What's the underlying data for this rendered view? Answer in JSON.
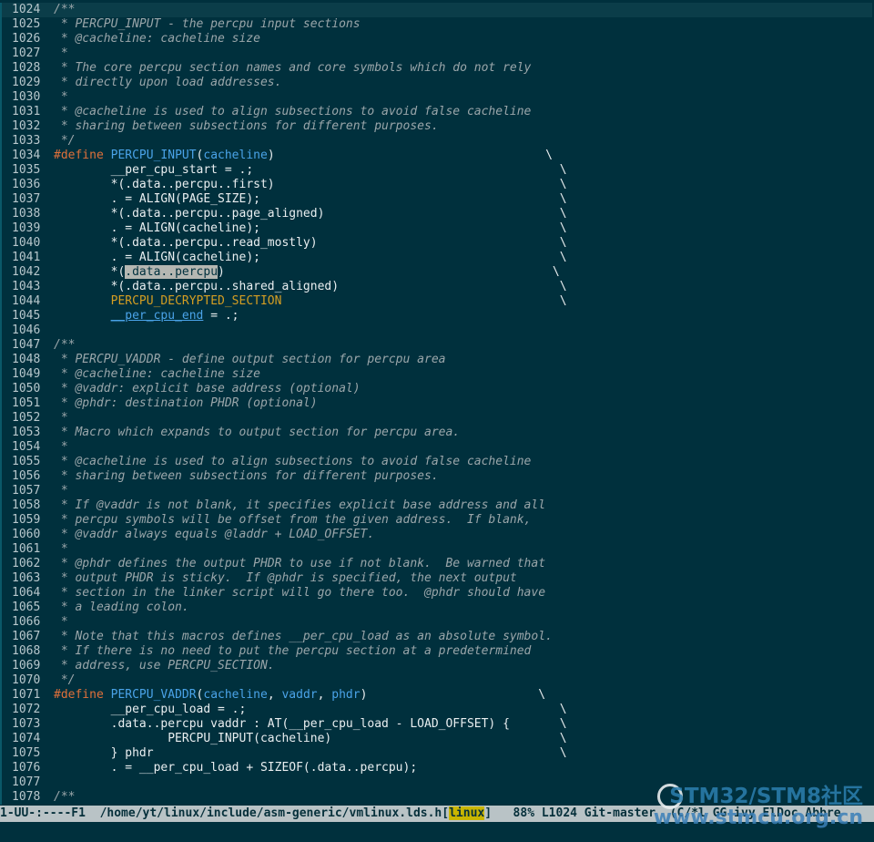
{
  "lines": [
    {
      "n": "1024",
      "current": true,
      "segs": [
        [
          "c",
          "/**"
        ]
      ]
    },
    {
      "n": "1025",
      "segs": [
        [
          "c",
          " * PERCPU_INPUT - the percpu input sections"
        ]
      ]
    },
    {
      "n": "1026",
      "segs": [
        [
          "c",
          " * @cacheline: cacheline size"
        ]
      ]
    },
    {
      "n": "1027",
      "segs": [
        [
          "c",
          " *"
        ]
      ]
    },
    {
      "n": "1028",
      "segs": [
        [
          "c",
          " * The core percpu section names and core symbols which do not rely"
        ]
      ]
    },
    {
      "n": "1029",
      "segs": [
        [
          "c",
          " * directly upon load addresses."
        ]
      ]
    },
    {
      "n": "1030",
      "segs": [
        [
          "c",
          " *"
        ]
      ]
    },
    {
      "n": "1031",
      "segs": [
        [
          "c",
          " * @cacheline is used to align subsections to avoid false cacheline"
        ]
      ]
    },
    {
      "n": "1032",
      "segs": [
        [
          "c",
          " * sharing between subsections for different purposes."
        ]
      ]
    },
    {
      "n": "1033",
      "segs": [
        [
          "c",
          " */"
        ]
      ]
    },
    {
      "n": "1034",
      "segs": [
        [
          "k",
          "#define"
        ],
        [
          "t",
          " "
        ],
        [
          "f",
          "PERCPU_INPUT"
        ],
        [
          "t",
          "("
        ],
        [
          "v",
          "cacheline"
        ],
        [
          "t",
          ")                                      \\"
        ]
      ]
    },
    {
      "n": "1035",
      "segs": [
        [
          "t",
          "        __per_cpu_start = .;                                           \\"
        ]
      ]
    },
    {
      "n": "1036",
      "segs": [
        [
          "t",
          "        *(.data..percpu..first)                                        \\"
        ]
      ]
    },
    {
      "n": "1037",
      "segs": [
        [
          "t",
          "        . = ALIGN(PAGE_SIZE);                                          \\"
        ]
      ]
    },
    {
      "n": "1038",
      "segs": [
        [
          "t",
          "        *(.data..percpu..page_aligned)                                 \\"
        ]
      ]
    },
    {
      "n": "1039",
      "segs": [
        [
          "t",
          "        . = ALIGN(cacheline);                                          \\"
        ]
      ]
    },
    {
      "n": "1040",
      "segs": [
        [
          "t",
          "        *(.data..percpu..read_mostly)                                  \\"
        ]
      ]
    },
    {
      "n": "1041",
      "segs": [
        [
          "t",
          "        . = ALIGN(cacheline);                                          \\"
        ]
      ]
    },
    {
      "n": "1042",
      "segs": [
        [
          "t",
          "        *("
        ],
        [
          "hl",
          ".data..percpu"
        ],
        [
          "t",
          ")                                              \\"
        ]
      ]
    },
    {
      "n": "1043",
      "segs": [
        [
          "t",
          "        *(.data..percpu..shared_aligned)                               \\"
        ]
      ]
    },
    {
      "n": "1044",
      "segs": [
        [
          "t",
          "        "
        ],
        [
          "s",
          "PERCPU_DECRYPTED_SECTION"
        ],
        [
          "t",
          "                                       \\"
        ]
      ]
    },
    {
      "n": "1045",
      "segs": [
        [
          "t",
          "        "
        ],
        [
          "u",
          "__per_cpu_end"
        ],
        [
          "t",
          " = .;"
        ]
      ]
    },
    {
      "n": "1046",
      "segs": [
        [
          "t",
          ""
        ]
      ]
    },
    {
      "n": "1047",
      "segs": [
        [
          "c",
          "/**"
        ]
      ]
    },
    {
      "n": "1048",
      "segs": [
        [
          "c",
          " * PERCPU_VADDR - define output section for percpu area"
        ]
      ]
    },
    {
      "n": "1049",
      "segs": [
        [
          "c",
          " * @cacheline: cacheline size"
        ]
      ]
    },
    {
      "n": "1050",
      "segs": [
        [
          "c",
          " * @vaddr: explicit base address (optional)"
        ]
      ]
    },
    {
      "n": "1051",
      "segs": [
        [
          "c",
          " * @phdr: destination PHDR (optional)"
        ]
      ]
    },
    {
      "n": "1052",
      "segs": [
        [
          "c",
          " *"
        ]
      ]
    },
    {
      "n": "1053",
      "segs": [
        [
          "c",
          " * Macro which expands to output section for percpu area."
        ]
      ]
    },
    {
      "n": "1054",
      "segs": [
        [
          "c",
          " *"
        ]
      ]
    },
    {
      "n": "1055",
      "segs": [
        [
          "c",
          " * @cacheline is used to align subsections to avoid false cacheline"
        ]
      ]
    },
    {
      "n": "1056",
      "segs": [
        [
          "c",
          " * sharing between subsections for different purposes."
        ]
      ]
    },
    {
      "n": "1057",
      "segs": [
        [
          "c",
          " *"
        ]
      ]
    },
    {
      "n": "1058",
      "segs": [
        [
          "c",
          " * If @vaddr is not blank, it specifies explicit base address and all"
        ]
      ]
    },
    {
      "n": "1059",
      "segs": [
        [
          "c",
          " * percpu symbols will be offset from the given address.  If blank,"
        ]
      ]
    },
    {
      "n": "1060",
      "segs": [
        [
          "c",
          " * @vaddr always equals @laddr + LOAD_OFFSET."
        ]
      ]
    },
    {
      "n": "1061",
      "segs": [
        [
          "c",
          " *"
        ]
      ]
    },
    {
      "n": "1062",
      "segs": [
        [
          "c",
          " * @phdr defines the output PHDR to use if not blank.  Be warned that"
        ]
      ]
    },
    {
      "n": "1063",
      "segs": [
        [
          "c",
          " * output PHDR is sticky.  If @phdr is specified, the next output"
        ]
      ]
    },
    {
      "n": "1064",
      "segs": [
        [
          "c",
          " * section in the linker script will go there too.  @phdr should have"
        ]
      ]
    },
    {
      "n": "1065",
      "segs": [
        [
          "c",
          " * a leading colon."
        ]
      ]
    },
    {
      "n": "1066",
      "segs": [
        [
          "c",
          " *"
        ]
      ]
    },
    {
      "n": "1067",
      "segs": [
        [
          "c",
          " * Note that this macros defines __per_cpu_load as an absolute symbol."
        ]
      ]
    },
    {
      "n": "1068",
      "segs": [
        [
          "c",
          " * If there is no need to put the percpu section at a predetermined"
        ]
      ]
    },
    {
      "n": "1069",
      "segs": [
        [
          "c",
          " * address, use PERCPU_SECTION."
        ]
      ]
    },
    {
      "n": "1070",
      "segs": [
        [
          "c",
          " */"
        ]
      ]
    },
    {
      "n": "1071",
      "segs": [
        [
          "k",
          "#define"
        ],
        [
          "t",
          " "
        ],
        [
          "f",
          "PERCPU_VADDR"
        ],
        [
          "t",
          "("
        ],
        [
          "v",
          "cacheline"
        ],
        [
          "t",
          ", "
        ],
        [
          "v",
          "vaddr"
        ],
        [
          "t",
          ", "
        ],
        [
          "v",
          "phdr"
        ],
        [
          "t",
          ")                        \\"
        ]
      ]
    },
    {
      "n": "1072",
      "segs": [
        [
          "t",
          "        __per_cpu_load = .;                                            \\"
        ]
      ]
    },
    {
      "n": "1073",
      "segs": [
        [
          "t",
          "        .data..percpu vaddr : AT(__per_cpu_load - LOAD_OFFSET) {       \\"
        ]
      ]
    },
    {
      "n": "1074",
      "segs": [
        [
          "t",
          "                PERCPU_INPUT(cacheline)                                \\"
        ]
      ]
    },
    {
      "n": "1075",
      "segs": [
        [
          "t",
          "        } phdr                                                         \\"
        ]
      ]
    },
    {
      "n": "1076",
      "segs": [
        [
          "t",
          "        . = __per_cpu_load + SIZEOF(.data..percpu);"
        ]
      ]
    },
    {
      "n": "1077",
      "segs": [
        [
          "t",
          ""
        ]
      ]
    },
    {
      "n": "1078",
      "segs": [
        [
          "c",
          "/**"
        ]
      ]
    }
  ],
  "modeline": {
    "prefix": "1-UU-:----F1  /home/yt/linux/include/asm-generic/vmlinux.lds.h[",
    "tag": "linux",
    "suffix": "]   88% L1024 Git-master  (C/*l GG ivy ElDoc Abbre"
  },
  "watermark": {
    "line1": "STM32/STM8社区",
    "line2": "www.stmcu.org.cn"
  }
}
